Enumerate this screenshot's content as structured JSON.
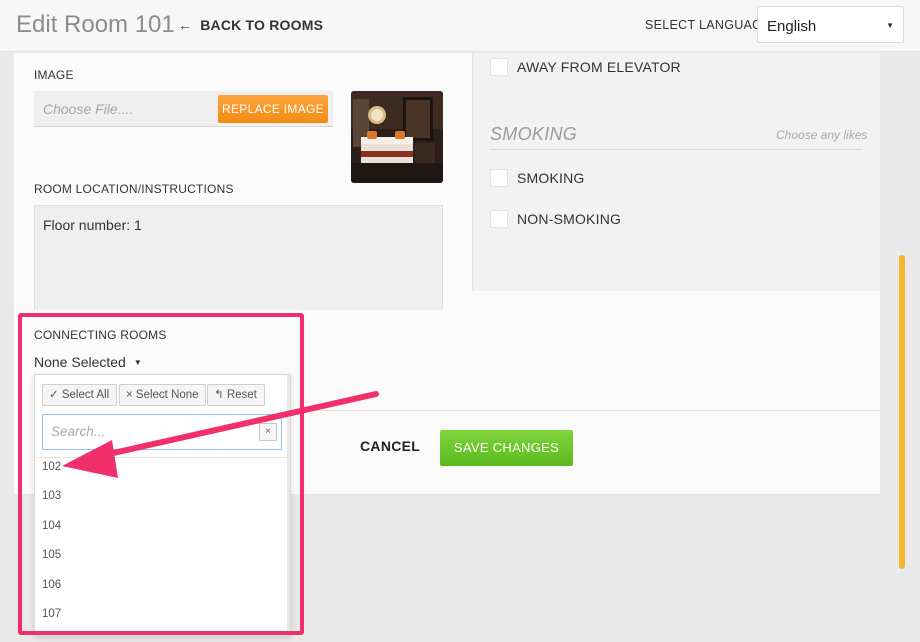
{
  "header": {
    "title": "Edit Room 101",
    "back_label": "BACK TO ROOMS",
    "back_arrow": "←",
    "language_label": "SELECT LANGUAGE",
    "language_value": "English"
  },
  "image_field": {
    "label": "IMAGE",
    "file_placeholder": "Choose File....",
    "replace_button": "REPLACE IMAGE"
  },
  "location_field": {
    "label": "ROOM LOCATION/INSTRUCTIONS",
    "value": "Floor number: 1"
  },
  "right_column": {
    "away_label": "AWAY FROM ELEVATOR",
    "smoking_section": {
      "title": "SMOKING",
      "hint": "Choose any likes",
      "options": [
        "SMOKING",
        "NON-SMOKING"
      ]
    }
  },
  "connecting_rooms": {
    "label": "CONNECTING ROOMS",
    "selected_text": "None Selected",
    "buttons": {
      "select_all": "✓ Select All",
      "select_none": "× Select None",
      "reset": "↰ Reset"
    },
    "search_placeholder": "Search...",
    "clear_glyph": "×",
    "options": [
      "102",
      "103",
      "104",
      "105",
      "106",
      "107"
    ]
  },
  "actions": {
    "cancel": "CANCEL",
    "save": "SAVE CHANGES"
  },
  "colors": {
    "save_green": "#5cb91f",
    "replace_orange": "#f38b12",
    "annotation_pink": "#f1306b",
    "scrollbar_yellow": "#f5b52b"
  }
}
